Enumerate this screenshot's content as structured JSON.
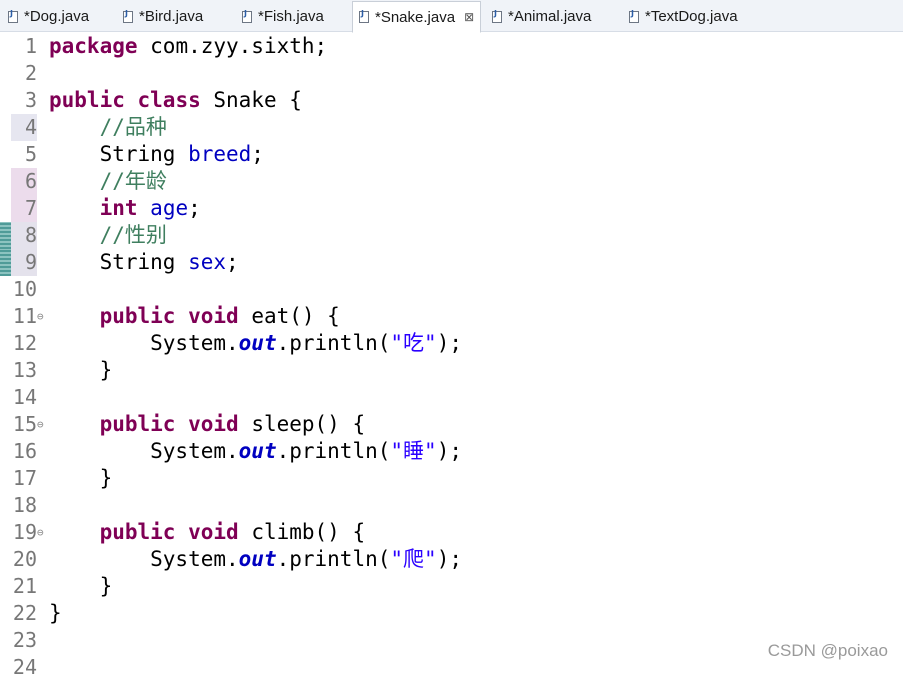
{
  "tabs": [
    {
      "label": "*Dog.java",
      "active": false
    },
    {
      "label": "*Bird.java",
      "active": false
    },
    {
      "label": "*Fish.java",
      "active": false
    },
    {
      "label": "*Snake.java",
      "active": true
    },
    {
      "label": "*Animal.java",
      "active": false
    },
    {
      "label": "*TextDog.java",
      "active": false
    }
  ],
  "close_glyph": "⊠",
  "lines": [
    {
      "n": "1",
      "tokens": [
        {
          "t": "package",
          "c": "kw"
        },
        {
          "t": " com.zyy.sixth;",
          "c": ""
        }
      ]
    },
    {
      "n": "2",
      "tokens": []
    },
    {
      "n": "3",
      "tokens": [
        {
          "t": "public",
          "c": "kw"
        },
        {
          "t": " ",
          "c": ""
        },
        {
          "t": "class",
          "c": "kw"
        },
        {
          "t": " Snake {",
          "c": ""
        }
      ]
    },
    {
      "n": "4",
      "tokens": [
        {
          "t": "    ",
          "c": ""
        },
        {
          "t": "//品种",
          "c": "cmt"
        }
      ]
    },
    {
      "n": "5",
      "tokens": [
        {
          "t": "    String ",
          "c": ""
        },
        {
          "t": "breed",
          "c": "fld"
        },
        {
          "t": ";",
          "c": ""
        }
      ]
    },
    {
      "n": "6",
      "tokens": [
        {
          "t": "    ",
          "c": ""
        },
        {
          "t": "//年龄",
          "c": "cmt"
        }
      ]
    },
    {
      "n": "7",
      "tokens": [
        {
          "t": "    ",
          "c": ""
        },
        {
          "t": "int",
          "c": "kw"
        },
        {
          "t": " ",
          "c": ""
        },
        {
          "t": "age",
          "c": "fld"
        },
        {
          "t": ";",
          "c": ""
        }
      ]
    },
    {
      "n": "8",
      "tokens": [
        {
          "t": "    ",
          "c": ""
        },
        {
          "t": "//性别",
          "c": "cmt"
        }
      ]
    },
    {
      "n": "9",
      "tokens": [
        {
          "t": "    String ",
          "c": ""
        },
        {
          "t": "sex",
          "c": "fld"
        },
        {
          "t": ";",
          "c": ""
        }
      ]
    },
    {
      "n": "10",
      "tokens": []
    },
    {
      "n": "11",
      "fold": true,
      "tokens": [
        {
          "t": "    ",
          "c": ""
        },
        {
          "t": "public",
          "c": "kw"
        },
        {
          "t": " ",
          "c": ""
        },
        {
          "t": "void",
          "c": "kw"
        },
        {
          "t": " eat() {",
          "c": ""
        }
      ]
    },
    {
      "n": "12",
      "tokens": [
        {
          "t": "        System.",
          "c": ""
        },
        {
          "t": "out",
          "c": "sfld"
        },
        {
          "t": ".println(",
          "c": ""
        },
        {
          "t": "\"吃\"",
          "c": "str"
        },
        {
          "t": ");",
          "c": ""
        }
      ]
    },
    {
      "n": "13",
      "tokens": [
        {
          "t": "    }",
          "c": ""
        }
      ]
    },
    {
      "n": "14",
      "tokens": []
    },
    {
      "n": "15",
      "fold": true,
      "tokens": [
        {
          "t": "    ",
          "c": ""
        },
        {
          "t": "public",
          "c": "kw"
        },
        {
          "t": " ",
          "c": ""
        },
        {
          "t": "void",
          "c": "kw"
        },
        {
          "t": " sleep() {",
          "c": ""
        }
      ]
    },
    {
      "n": "16",
      "tokens": [
        {
          "t": "        System.",
          "c": ""
        },
        {
          "t": "out",
          "c": "sfld"
        },
        {
          "t": ".println(",
          "c": ""
        },
        {
          "t": "\"睡\"",
          "c": "str"
        },
        {
          "t": ");",
          "c": ""
        }
      ]
    },
    {
      "n": "17",
      "tokens": [
        {
          "t": "    }",
          "c": ""
        }
      ]
    },
    {
      "n": "18",
      "tokens": []
    },
    {
      "n": "19",
      "fold": true,
      "tokens": [
        {
          "t": "    ",
          "c": ""
        },
        {
          "t": "public",
          "c": "kw"
        },
        {
          "t": " ",
          "c": ""
        },
        {
          "t": "void",
          "c": "kw"
        },
        {
          "t": " climb() {",
          "c": ""
        }
      ]
    },
    {
      "n": "20",
      "tokens": [
        {
          "t": "        System.",
          "c": ""
        },
        {
          "t": "out",
          "c": "sfld"
        },
        {
          "t": ".println(",
          "c": ""
        },
        {
          "t": "\"爬\"",
          "c": "str"
        },
        {
          "t": ");",
          "c": ""
        }
      ]
    },
    {
      "n": "21",
      "tokens": [
        {
          "t": "    }",
          "c": ""
        }
      ]
    },
    {
      "n": "22",
      "tokens": [
        {
          "t": "}",
          "c": ""
        }
      ]
    },
    {
      "n": "23",
      "tokens": []
    },
    {
      "n": "24",
      "tokens": []
    }
  ],
  "fold_glyph": "⊖",
  "colors": {
    "keyword": "#7f0055",
    "field": "#0000c0",
    "comment": "#3f7f5f",
    "string": "#2a00ff",
    "change_bar": "#5fa3a0",
    "selected_line": "#e4e2f0"
  },
  "watermark": "CSDN @poixao"
}
